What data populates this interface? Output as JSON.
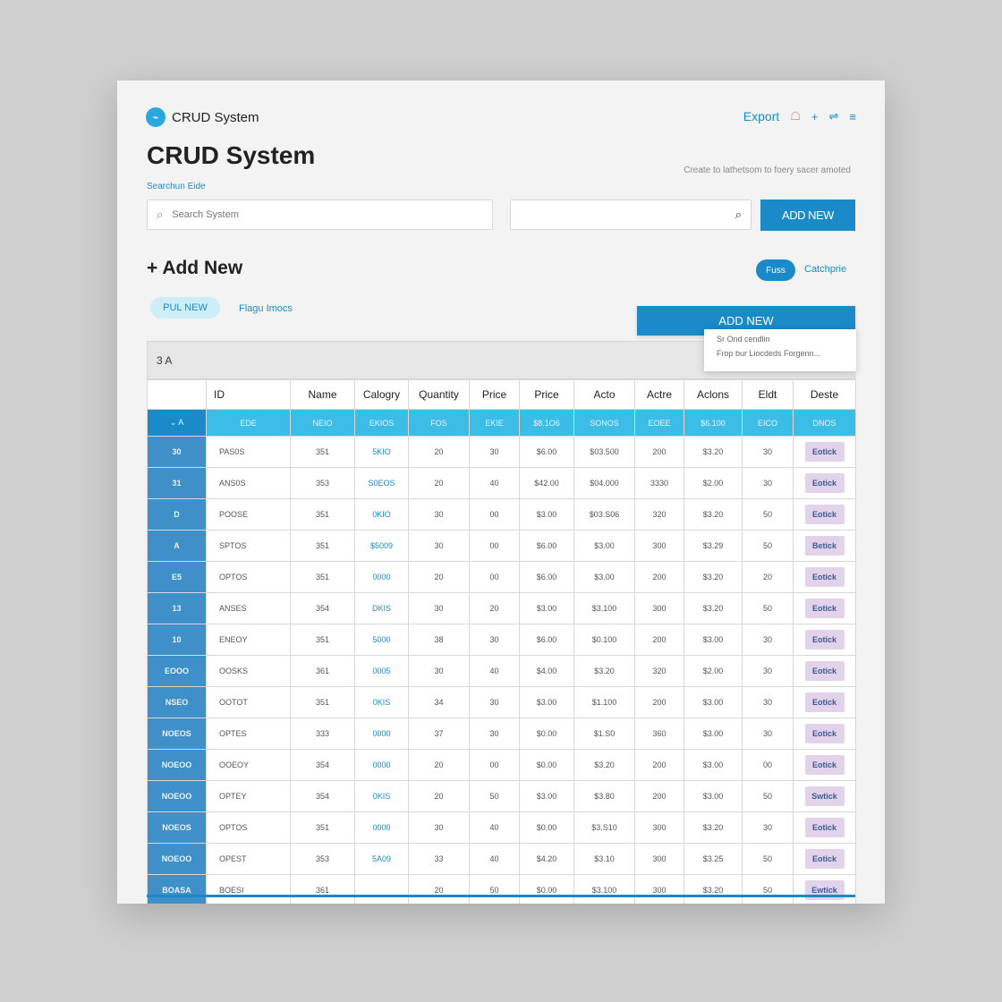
{
  "header": {
    "brand_name": "CRUD System",
    "export_label": "Export",
    "icons": [
      "user-icon",
      "plus-icon",
      "sort-icon",
      "menu-icon"
    ],
    "icon_glyphs": [
      "☖",
      "+",
      "⇌",
      "≡"
    ]
  },
  "page_title": "CRUD System",
  "hint_text": "Create to lathetsom to foery sacer amoted",
  "search": {
    "caption": "Searchun Eide",
    "placeholder": "Search System",
    "secondary_placeholder": "",
    "button_label": "ADD NEW"
  },
  "section": {
    "title": "+ Add New",
    "pill_filled": "Fuss",
    "link_right": "Catchprie",
    "pill_light": "PUL NEW",
    "link_left": "Flagu Imocs",
    "add_button": "ADD NEW",
    "dropdown_items": [
      "Sr Ond cendlin",
      "Frop bur Liocdeds Forgenn..."
    ]
  },
  "table": {
    "caption": "3 A",
    "columns": [
      "",
      "ID",
      "Name",
      "Calogry",
      "Quantity",
      "Price",
      "Price",
      "Acto",
      "Actre",
      "Aclons",
      "Eldt",
      "Deste"
    ],
    "subheader": [
      "⌄ A",
      "EDE",
      "NEIO",
      "EKIOS",
      "FOS",
      "EKIE",
      "$8.1O6",
      "SONOS",
      "EOEE",
      "$6.100",
      "EICO",
      "DNOS"
    ],
    "rows": [
      {
        "id": "30",
        "name": "PAS0S",
        "c1": "351",
        "cat": "5KIO",
        "q": "20",
        "p1": "30",
        "p2": "$6.00",
        "a1": "$03.500",
        "a2": "200",
        "a3": "$3.20",
        "a4": "30",
        "btn": "Eotick"
      },
      {
        "id": "31",
        "name": "ANS0S",
        "c1": "353",
        "cat": "S0EOS",
        "q": "20",
        "p1": "40",
        "p2": "$42.00",
        "a1": "$04.000",
        "a2": "3330",
        "a3": "$2.00",
        "a4": "30",
        "btn": "Eotick"
      },
      {
        "id": "D",
        "name": "POOSE",
        "c1": "351",
        "cat": "0KIO",
        "q": "30",
        "p1": "00",
        "p2": "$3.00",
        "a1": "$03.S06",
        "a2": "320",
        "a3": "$3.20",
        "a4": "50",
        "btn": "Eotick"
      },
      {
        "id": "A",
        "name": "SPTOS",
        "c1": "351",
        "cat": "$5009",
        "q": "30",
        "p1": "00",
        "p2": "$6.00",
        "a1": "$3.00",
        "a2": "300",
        "a3": "$3.29",
        "a4": "50",
        "btn": "Betick"
      },
      {
        "id": "E5",
        "name": "OPTOS",
        "c1": "351",
        "cat": "0000",
        "q": "20",
        "p1": "00",
        "p2": "$6.00",
        "a1": "$3.00",
        "a2": "200",
        "a3": "$3.20",
        "a4": "20",
        "btn": "Eotick"
      },
      {
        "id": "13",
        "name": "ANSES",
        "c1": "354",
        "cat": "DKIS",
        "q": "30",
        "p1": "20",
        "p2": "$3.00",
        "a1": "$3.100",
        "a2": "300",
        "a3": "$3.20",
        "a4": "50",
        "btn": "Eotick"
      },
      {
        "id": "10",
        "name": "ENEOY",
        "c1": "351",
        "cat": "5000",
        "q": "38",
        "p1": "30",
        "p2": "$6.00",
        "a1": "$0.100",
        "a2": "200",
        "a3": "$3.00",
        "a4": "30",
        "btn": "Eotick"
      },
      {
        "id": "EOOO",
        "name": "OOSKS",
        "c1": "361",
        "cat": "0005",
        "q": "30",
        "p1": "40",
        "p2": "$4.00",
        "a1": "$3.20",
        "a2": "320",
        "a3": "$2.00",
        "a4": "30",
        "btn": "Eotick"
      },
      {
        "id": "NSEO",
        "name": "OOTOT",
        "c1": "351",
        "cat": "0KIS",
        "q": "34",
        "p1": "30",
        "p2": "$3.00",
        "a1": "$1.100",
        "a2": "200",
        "a3": "$3.00",
        "a4": "30",
        "btn": "Eotick"
      },
      {
        "id": "NOEOS",
        "name": "OPTES",
        "c1": "333",
        "cat": "0000",
        "q": "37",
        "p1": "30",
        "p2": "$0.00",
        "a1": "$1.S0",
        "a2": "360",
        "a3": "$3.00",
        "a4": "30",
        "btn": "Eotick"
      },
      {
        "id": "NOEOO",
        "name": "OOEOY",
        "c1": "354",
        "cat": "0000",
        "q": "20",
        "p1": "00",
        "p2": "$0.00",
        "a1": "$3.20",
        "a2": "200",
        "a3": "$3.00",
        "a4": "00",
        "btn": "Eotick"
      },
      {
        "id": "NOEOO",
        "name": "OPTEY",
        "c1": "354",
        "cat": "0KIS",
        "q": "20",
        "p1": "50",
        "p2": "$3.00",
        "a1": "$3.80",
        "a2": "200",
        "a3": "$3.00",
        "a4": "50",
        "btn": "Swtick"
      },
      {
        "id": "NOEOS",
        "name": "OPTOS",
        "c1": "351",
        "cat": "0000",
        "q": "30",
        "p1": "40",
        "p2": "$0.00",
        "a1": "$3.S10",
        "a2": "300",
        "a3": "$3.20",
        "a4": "30",
        "btn": "Eotick"
      },
      {
        "id": "NOEOO",
        "name": "OPEST",
        "c1": "353",
        "cat": "5A09",
        "q": "33",
        "p1": "40",
        "p2": "$4.20",
        "a1": "$3.10",
        "a2": "300",
        "a3": "$3.25",
        "a4": "50",
        "btn": "Eotick"
      },
      {
        "id": "BOASA",
        "name": "BOESI",
        "c1": "361",
        "cat": "",
        "q": "20",
        "p1": "50",
        "p2": "$0.00",
        "a1": "$3.100",
        "a2": "300",
        "a3": "$3.20",
        "a4": "50",
        "btn": "Ewtick"
      }
    ]
  },
  "colors": {
    "accent": "#1a8ac8",
    "header_row": "#3bbde8",
    "id_column": "#3f8fc8",
    "action_button": "#e3d3ea"
  }
}
